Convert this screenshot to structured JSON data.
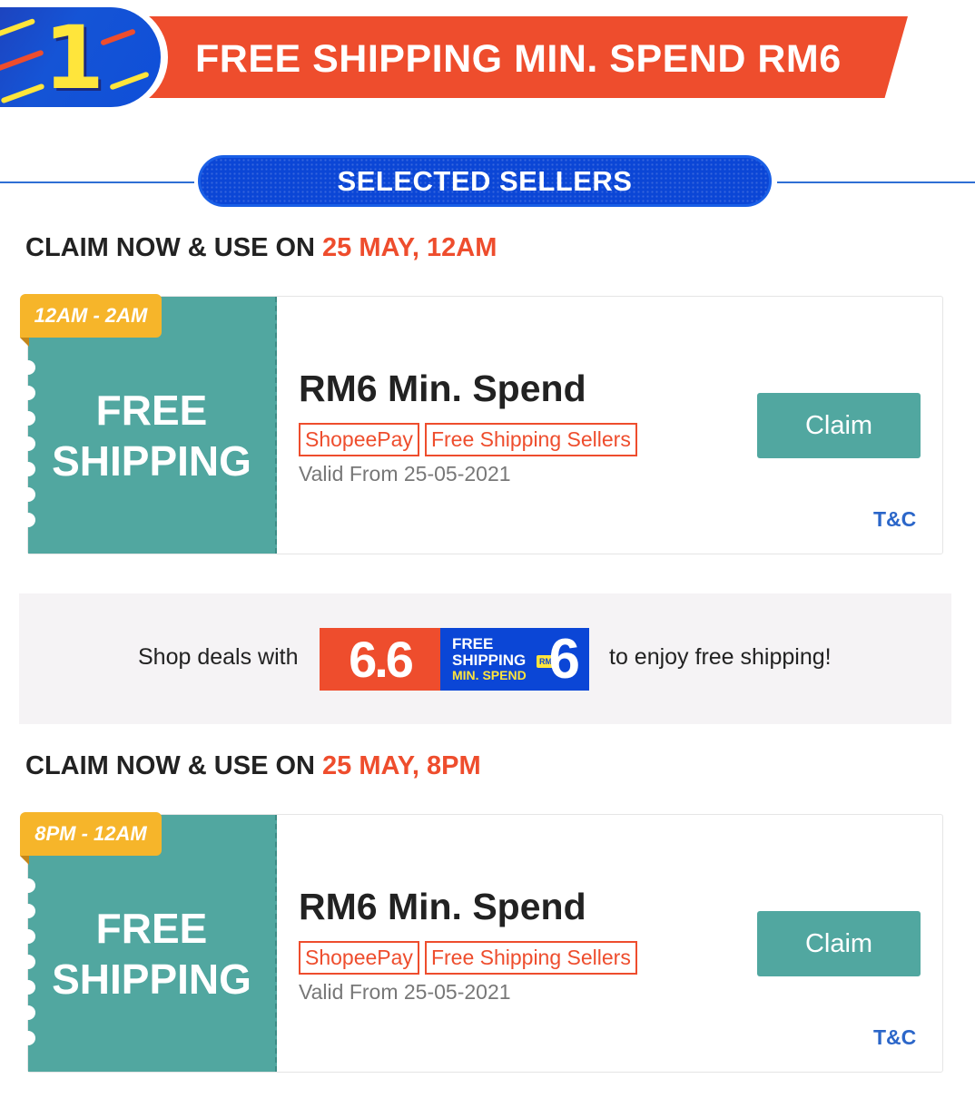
{
  "banner": {
    "number": "1",
    "title": "FREE SHIPPING MIN. SPEND RM6"
  },
  "section_pill": "SELECTED SELLERS",
  "sections": [
    {
      "heading_prefix": "CLAIM NOW & USE ON ",
      "heading_highlight": "25 MAY, 12AM",
      "voucher": {
        "time_tag": "12AM - 2AM",
        "free_label_line1": "FREE",
        "free_label_line2": "SHIPPING",
        "title": "RM6 Min. Spend",
        "tags": [
          "ShopeePay",
          "Free Shipping Sellers"
        ],
        "valid": "Valid From 25-05-2021",
        "claim_label": "Claim",
        "tnc_label": "T&C"
      }
    },
    {
      "heading_prefix": "CLAIM NOW & USE ON ",
      "heading_highlight": "25 MAY, 8PM",
      "voucher": {
        "time_tag": "8PM - 12AM",
        "free_label_line1": "FREE",
        "free_label_line2": "SHIPPING",
        "title": "RM6 Min. Spend",
        "tags": [
          "ShopeePay",
          "Free Shipping Sellers"
        ],
        "valid": "Valid From 25-05-2021",
        "claim_label": "Claim",
        "tnc_label": "T&C"
      }
    }
  ],
  "promo": {
    "text_before": "Shop deals with",
    "text_after": "to enjoy free shipping!",
    "logo": {
      "red_text": "6.6",
      "line1": "FREE",
      "line2": "SHIPPING",
      "line3": "MIN. SPEND",
      "rm": "RM",
      "six": "6"
    }
  },
  "colors": {
    "brand_orange": "#ee4d2d",
    "teal": "#51a7a0",
    "blue": "#0b46d6",
    "yellow": "#f6b52a",
    "link_blue": "#2b66c9"
  }
}
